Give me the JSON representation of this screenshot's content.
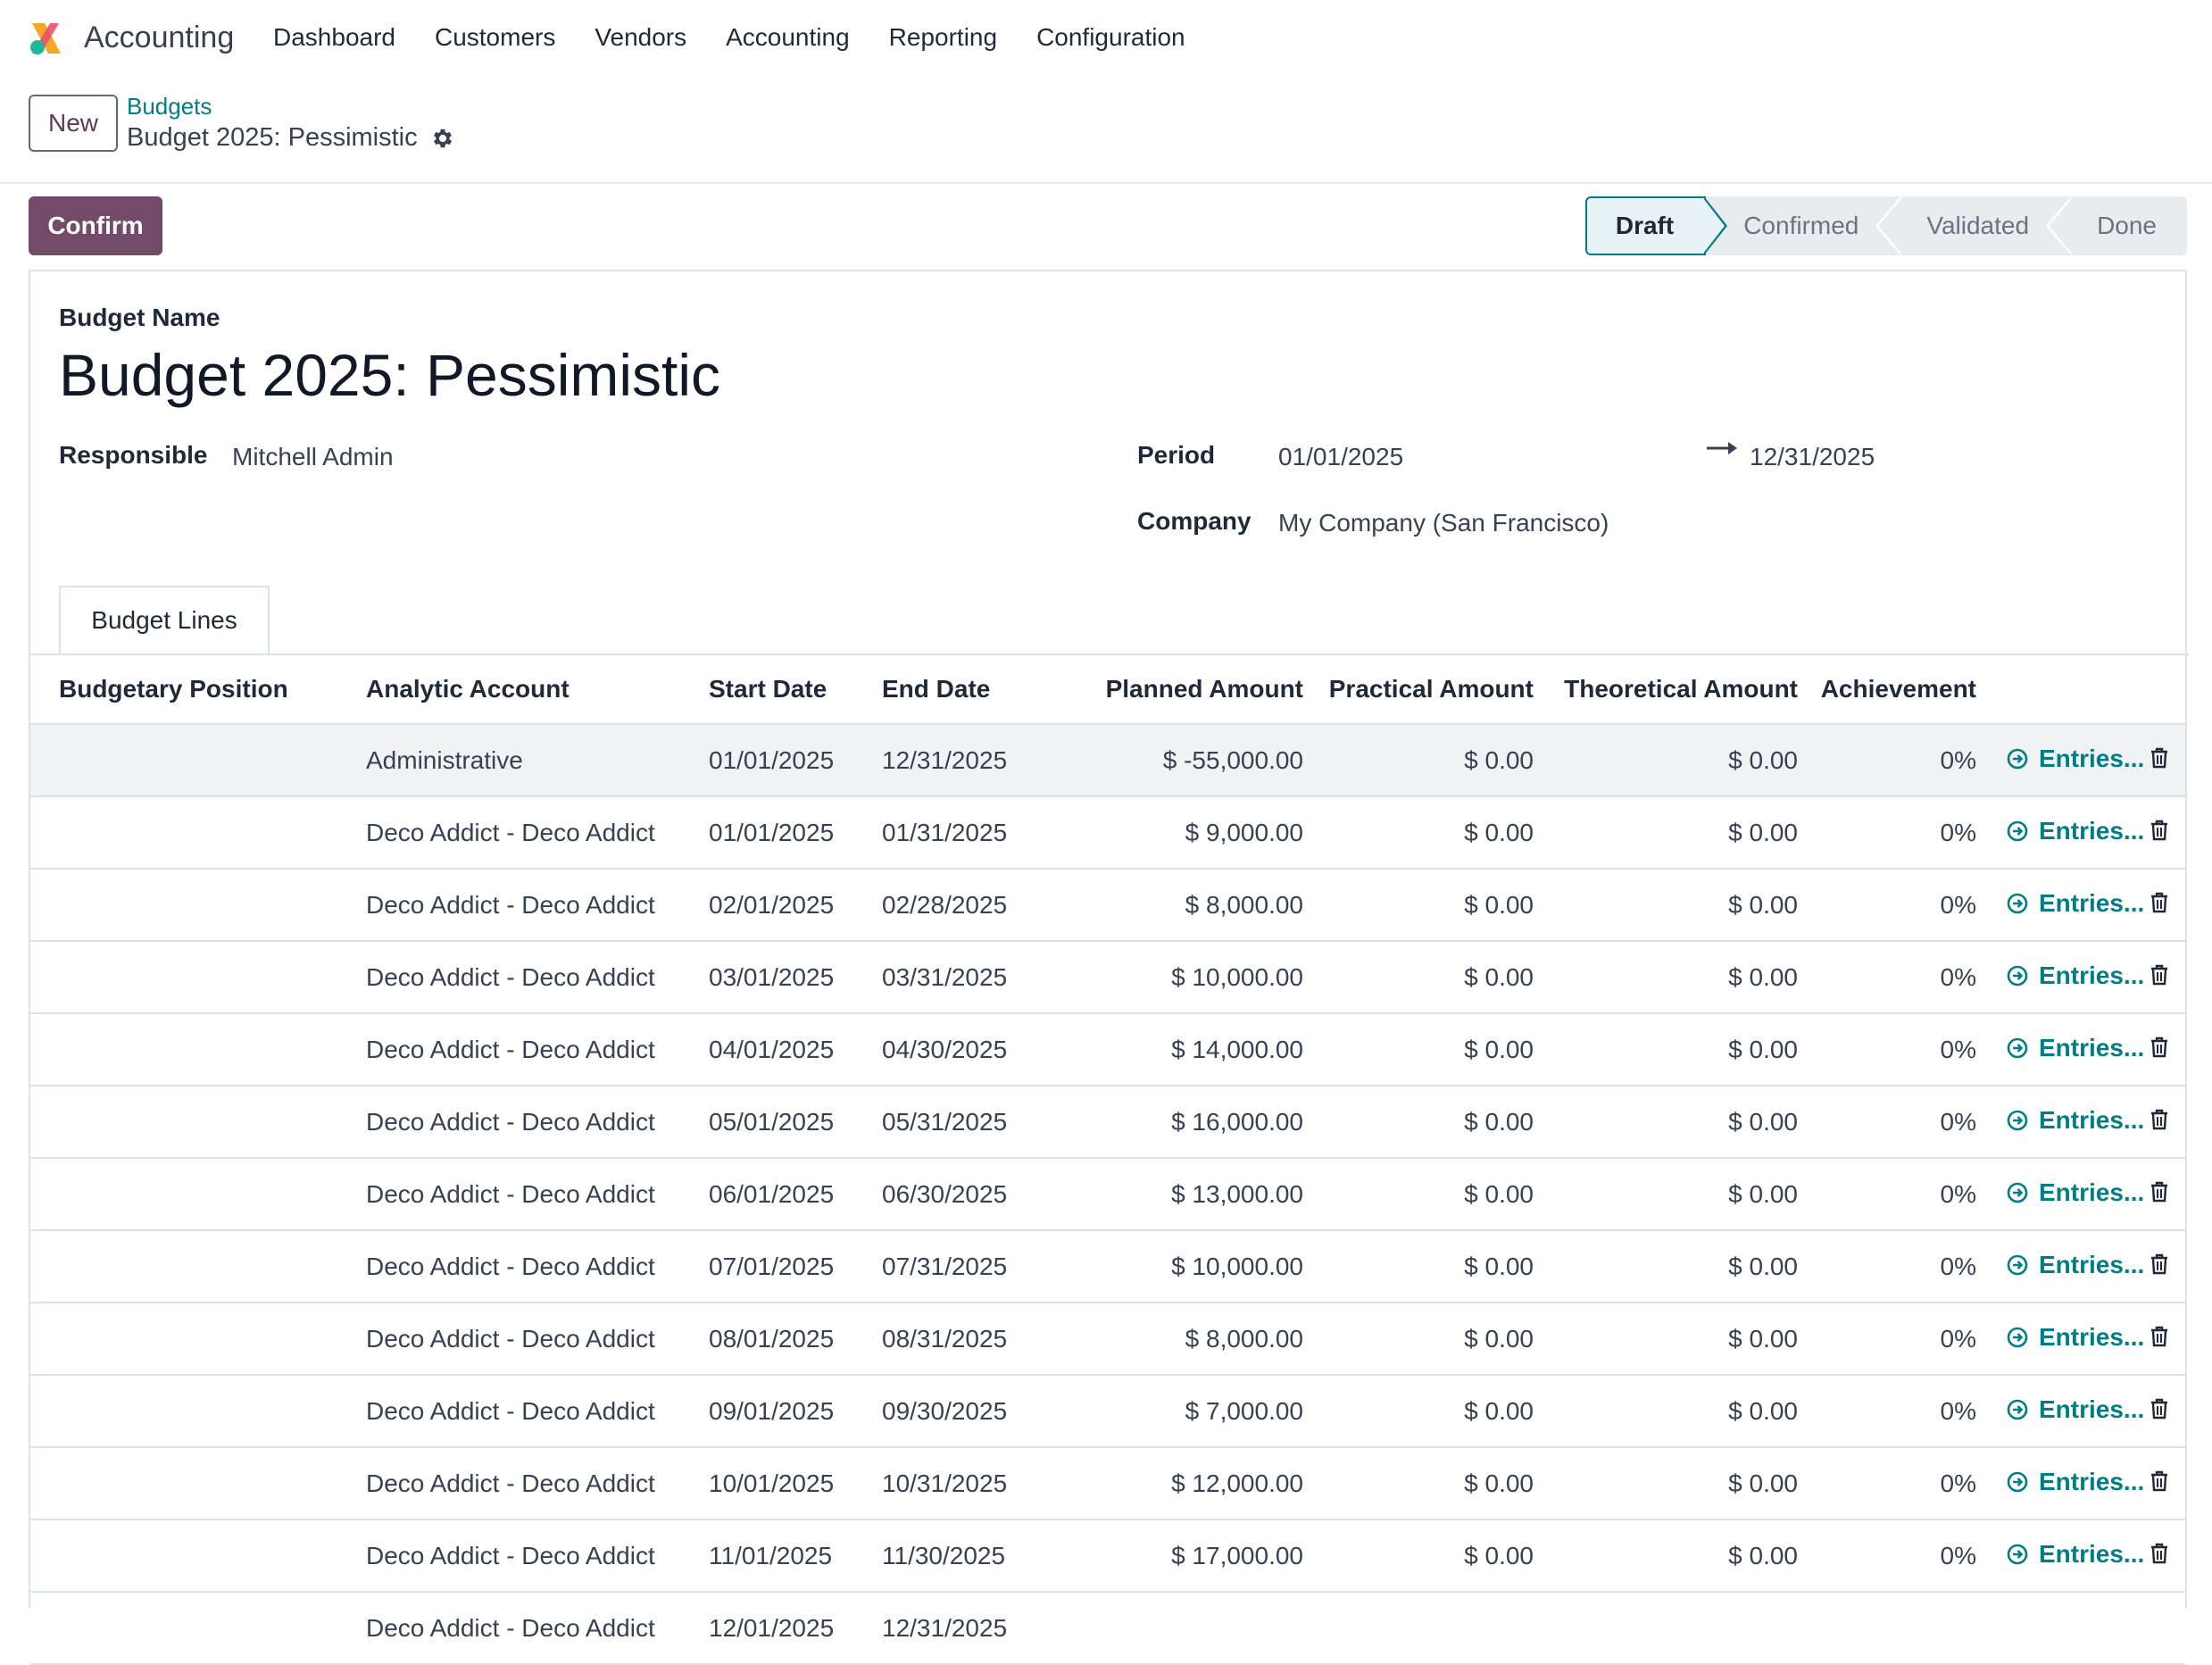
{
  "navbar": {
    "app_name": "Accounting",
    "menu": [
      "Dashboard",
      "Customers",
      "Vendors",
      "Accounting",
      "Reporting",
      "Configuration"
    ]
  },
  "control": {
    "new_label": "New",
    "breadcrumb": "Budgets",
    "record_title": "Budget 2025: Pessimistic"
  },
  "statusbar": {
    "confirm_label": "Confirm",
    "stages": [
      "Draft",
      "Confirmed",
      "Validated",
      "Done"
    ],
    "active_stage": "Draft"
  },
  "form": {
    "budget_name_label": "Budget Name",
    "budget_name": "Budget 2025: Pessimistic",
    "responsible_label": "Responsible",
    "responsible": "Mitchell Admin",
    "period_label": "Period",
    "period_start": "01/01/2025",
    "period_end": "12/31/2025",
    "company_label": "Company",
    "company": "My Company (San Francisco)"
  },
  "tabs": {
    "budget_lines": "Budget Lines"
  },
  "table": {
    "headers": [
      "Budgetary Position",
      "Analytic Account",
      "Start Date",
      "End Date",
      "Planned Amount",
      "Practical Amount",
      "Theoretical Amount",
      "Achievement"
    ],
    "entries_label": "Entries...",
    "rows": [
      {
        "position": "",
        "account": "Administrative",
        "start": "01/01/2025",
        "end": "12/31/2025",
        "planned": "$ -55,000.00",
        "practical": "$ 0.00",
        "theoretical": "$ 0.00",
        "achievement": "0%"
      },
      {
        "position": "",
        "account": "Deco Addict - Deco Addict",
        "start": "01/01/2025",
        "end": "01/31/2025",
        "planned": "$ 9,000.00",
        "practical": "$ 0.00",
        "theoretical": "$ 0.00",
        "achievement": "0%"
      },
      {
        "position": "",
        "account": "Deco Addict - Deco Addict",
        "start": "02/01/2025",
        "end": "02/28/2025",
        "planned": "$ 8,000.00",
        "practical": "$ 0.00",
        "theoretical": "$ 0.00",
        "achievement": "0%"
      },
      {
        "position": "",
        "account": "Deco Addict - Deco Addict",
        "start": "03/01/2025",
        "end": "03/31/2025",
        "planned": "$ 10,000.00",
        "practical": "$ 0.00",
        "theoretical": "$ 0.00",
        "achievement": "0%"
      },
      {
        "position": "",
        "account": "Deco Addict - Deco Addict",
        "start": "04/01/2025",
        "end": "04/30/2025",
        "planned": "$ 14,000.00",
        "practical": "$ 0.00",
        "theoretical": "$ 0.00",
        "achievement": "0%"
      },
      {
        "position": "",
        "account": "Deco Addict - Deco Addict",
        "start": "05/01/2025",
        "end": "05/31/2025",
        "planned": "$ 16,000.00",
        "practical": "$ 0.00",
        "theoretical": "$ 0.00",
        "achievement": "0%"
      },
      {
        "position": "",
        "account": "Deco Addict - Deco Addict",
        "start": "06/01/2025",
        "end": "06/30/2025",
        "planned": "$ 13,000.00",
        "practical": "$ 0.00",
        "theoretical": "$ 0.00",
        "achievement": "0%"
      },
      {
        "position": "",
        "account": "Deco Addict - Deco Addict",
        "start": "07/01/2025",
        "end": "07/31/2025",
        "planned": "$ 10,000.00",
        "practical": "$ 0.00",
        "theoretical": "$ 0.00",
        "achievement": "0%"
      },
      {
        "position": "",
        "account": "Deco Addict - Deco Addict",
        "start": "08/01/2025",
        "end": "08/31/2025",
        "planned": "$ 8,000.00",
        "practical": "$ 0.00",
        "theoretical": "$ 0.00",
        "achievement": "0%"
      },
      {
        "position": "",
        "account": "Deco Addict - Deco Addict",
        "start": "09/01/2025",
        "end": "09/30/2025",
        "planned": "$ 7,000.00",
        "practical": "$ 0.00",
        "theoretical": "$ 0.00",
        "achievement": "0%"
      },
      {
        "position": "",
        "account": "Deco Addict - Deco Addict",
        "start": "10/01/2025",
        "end": "10/31/2025",
        "planned": "$ 12,000.00",
        "practical": "$ 0.00",
        "theoretical": "$ 0.00",
        "achievement": "0%"
      },
      {
        "position": "",
        "account": "Deco Addict - Deco Addict",
        "start": "11/01/2025",
        "end": "11/30/2025",
        "planned": "$ 17,000.00",
        "practical": "$ 0.00",
        "theoretical": "$ 0.00",
        "achievement": "0%"
      },
      {
        "position": "",
        "account": "Deco Addict - Deco Addict",
        "start": "12/01/2025",
        "end": "12/31/2025",
        "planned": "",
        "practical": "",
        "theoretical": "",
        "achievement": ""
      }
    ]
  },
  "colors": {
    "brand": "#714b67",
    "accent": "#017e84"
  }
}
